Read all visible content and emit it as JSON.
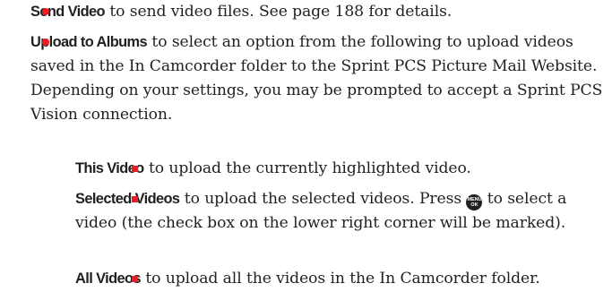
{
  "colors": {
    "accent": "#ec1c24",
    "text": "#231f20"
  },
  "items": [
    {
      "term": "Send Video",
      "text": " to send video files. See page 188 for details."
    },
    {
      "term": "Upload to Albums",
      "text": " to select an option from the following to upload videos saved in the In Camcorder folder to the Sprint PCS Picture Mail Website. Depending on your settings, you may be prompted to accept a Sprint PCS Vision connection."
    }
  ],
  "subitems": [
    {
      "term": "This Video",
      "text": " to upload the currently highlighted video."
    },
    {
      "term": "Selected Videos",
      "text_before": " to upload the selected videos. Press ",
      "key": {
        "icon": "menu-ok-key-icon",
        "line1": "MENU",
        "line2": "OK"
      },
      "text_after": " to select a video (the check box on the lower right corner will be marked)."
    },
    {
      "term": "All Videos",
      "text": " to upload all the videos in the In Camcorder folder."
    }
  ]
}
